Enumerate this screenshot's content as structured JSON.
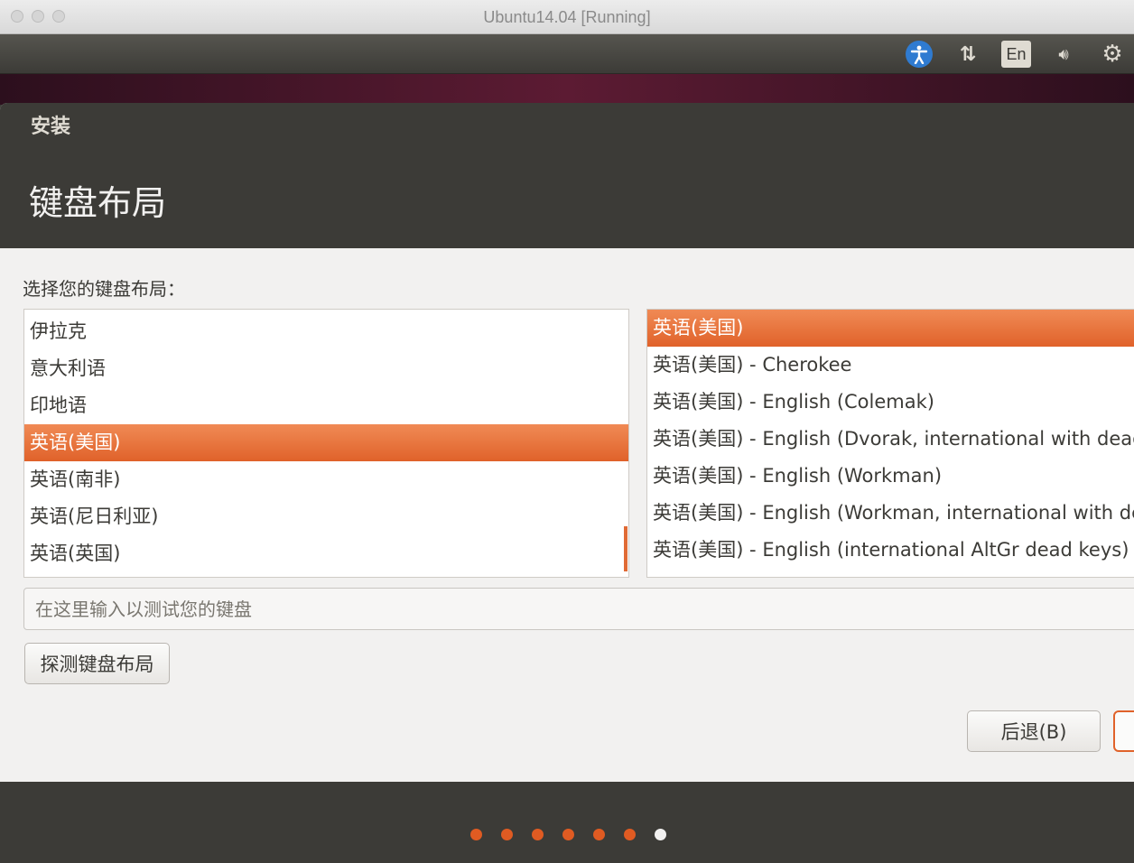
{
  "mac_window": {
    "title": "Ubuntu14.04 [Running]"
  },
  "panel": {
    "indicators": [
      {
        "icon": "accessibility-icon"
      },
      {
        "icon": "network-icon"
      },
      {
        "icon": "keyboard-indicator-icon",
        "label": "En"
      },
      {
        "icon": "volume-icon"
      },
      {
        "icon": "settings-gear-icon"
      }
    ]
  },
  "installer": {
    "window_title": "安装",
    "page_title": "键盘布局",
    "prompt": "选择您的键盘布局：",
    "layouts": [
      "伊拉克",
      "意大利语",
      "印地语",
      "英语(美国)",
      "英语(南非)",
      "英语(尼日利亚)",
      "英语(英国)"
    ],
    "selected_layout": "英语(美国)",
    "variants": [
      "英语(美国)",
      "英语(美国) - Cherokee",
      "英语(美国) - English (Colemak)",
      "英语(美国) - English (Dvorak, international with dead keys)",
      "英语(美国) - English (Workman)",
      "英语(美国) - English (Workman, international with dead keys)",
      "英语(美国) - English (international AltGr dead keys)"
    ],
    "selected_variant": "英语(美国)",
    "test_placeholder": "在这里输入以测试您的键盘",
    "detect_button": "探测键盘布局",
    "back_button": "后退(B)",
    "progress": {
      "total_steps": 7,
      "current_step": 7
    }
  },
  "colors": {
    "accent": "#e0622a",
    "panel": "#3c3b37",
    "background": "#f2f1f0"
  }
}
